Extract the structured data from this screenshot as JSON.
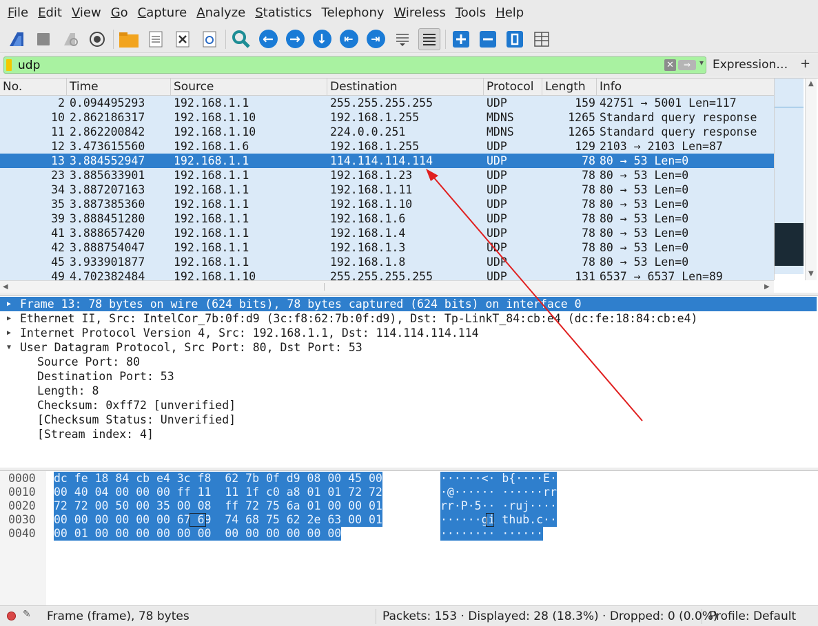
{
  "menu": [
    {
      "label": "File",
      "u": "F",
      "rest": "ile"
    },
    {
      "label": "Edit",
      "u": "E",
      "rest": "dit"
    },
    {
      "label": "View",
      "u": "V",
      "rest": "iew"
    },
    {
      "label": "Go",
      "u": "G",
      "rest": "o"
    },
    {
      "label": "Capture",
      "u": "C",
      "rest": "apture"
    },
    {
      "label": "Analyze",
      "u": "A",
      "rest": "nalyze"
    },
    {
      "label": "Statistics",
      "u": "S",
      "rest": "tatistics"
    },
    {
      "label": "Telephony",
      "u": "",
      "rest": "Telephony"
    },
    {
      "label": "Wireless",
      "u": "W",
      "rest": "ireless"
    },
    {
      "label": "Tools",
      "u": "T",
      "rest": "ools"
    },
    {
      "label": "Help",
      "u": "H",
      "rest": "elp"
    }
  ],
  "filter": {
    "value": "udp",
    "expression_label": "Expression…",
    "add_label": "+",
    "clear_label": "✕",
    "apply_label": "⇒",
    "dropdown_label": "▾"
  },
  "columns": {
    "no": "No.",
    "time": "Time",
    "source": "Source",
    "destination": "Destination",
    "protocol": "Protocol",
    "length": "Length",
    "info": "Info"
  },
  "packets": [
    {
      "no": "2",
      "time": "0.094495293",
      "source": "192.168.1.1",
      "destination": "255.255.255.255",
      "protocol": "UDP",
      "length": "159",
      "info": "42751 → 5001 Len=117"
    },
    {
      "no": "10",
      "time": "2.862186317",
      "source": "192.168.1.10",
      "destination": "192.168.1.255",
      "protocol": "MDNS",
      "length": "1265",
      "info": "Standard query response"
    },
    {
      "no": "11",
      "time": "2.862200842",
      "source": "192.168.1.10",
      "destination": "224.0.0.251",
      "protocol": "MDNS",
      "length": "1265",
      "info": "Standard query response"
    },
    {
      "no": "12",
      "time": "3.473615560",
      "source": "192.168.1.6",
      "destination": "192.168.1.255",
      "protocol": "UDP",
      "length": "129",
      "info": "2103 → 2103 Len=87"
    },
    {
      "no": "13",
      "time": "3.884552947",
      "source": "192.168.1.1",
      "destination": "114.114.114.114",
      "protocol": "UDP",
      "length": "78",
      "info": "80 → 53 Len=0",
      "selected": true
    },
    {
      "no": "23",
      "time": "3.885633901",
      "source": "192.168.1.1",
      "destination": "192.168.1.23",
      "protocol": "UDP",
      "length": "78",
      "info": "80 → 53 Len=0"
    },
    {
      "no": "34",
      "time": "3.887207163",
      "source": "192.168.1.1",
      "destination": "192.168.1.11",
      "protocol": "UDP",
      "length": "78",
      "info": "80 → 53 Len=0"
    },
    {
      "no": "35",
      "time": "3.887385360",
      "source": "192.168.1.1",
      "destination": "192.168.1.10",
      "protocol": "UDP",
      "length": "78",
      "info": "80 → 53 Len=0"
    },
    {
      "no": "39",
      "time": "3.888451280",
      "source": "192.168.1.1",
      "destination": "192.168.1.6",
      "protocol": "UDP",
      "length": "78",
      "info": "80 → 53 Len=0"
    },
    {
      "no": "41",
      "time": "3.888657420",
      "source": "192.168.1.1",
      "destination": "192.168.1.4",
      "protocol": "UDP",
      "length": "78",
      "info": "80 → 53 Len=0"
    },
    {
      "no": "42",
      "time": "3.888754047",
      "source": "192.168.1.1",
      "destination": "192.168.1.3",
      "protocol": "UDP",
      "length": "78",
      "info": "80 → 53 Len=0"
    },
    {
      "no": "45",
      "time": "3.933901877",
      "source": "192.168.1.1",
      "destination": "192.168.1.8",
      "protocol": "UDP",
      "length": "78",
      "info": "80 → 53 Len=0"
    },
    {
      "no": "49",
      "time": "4.702382484",
      "source": "192.168.1.10",
      "destination": "255.255.255.255",
      "protocol": "UDP",
      "length": "131",
      "info": "6537 → 6537 Len=89"
    }
  ],
  "details": {
    "frame": "Frame 13: 78 bytes on wire (624 bits), 78 bytes captured (624 bits) on interface 0",
    "ethernet": "Ethernet II, Src: IntelCor_7b:0f:d9 (3c:f8:62:7b:0f:d9), Dst: Tp-LinkT_84:cb:e4 (dc:fe:18:84:cb:e4)",
    "ip": "Internet Protocol Version 4, Src: 192.168.1.1, Dst: 114.114.114.114",
    "udp": "User Datagram Protocol, Src Port: 80, Dst Port: 53",
    "udp_fields": [
      "Source Port: 80",
      "Destination Port: 53",
      "Length: 8",
      "Checksum: 0xff72 [unverified]",
      "[Checksum Status: Unverified]",
      "[Stream index: 4]"
    ]
  },
  "bytes": [
    {
      "offset": "0000",
      "hex": "dc fe 18 84 cb e4 3c f8  62 7b 0f d9 08 00 45 00",
      "ascii": "······<· b{····E·"
    },
    {
      "offset": "0010",
      "hex": "00 40 04 00 00 00 ff 11  11 1f c0 a8 01 01 72 72",
      "ascii": "·@······ ······rr"
    },
    {
      "offset": "0020",
      "hex": "72 72 00 50 00 35 00 08  ff 72 75 6a 01 00 00 01",
      "ascii": "rr·P·5·· ·ruj····"
    },
    {
      "offset": "0030",
      "hex": "00 00 00 00 00 00 67 69  74 68 75 62 2e 63 00 01",
      "ascii": "······gi thub.c··"
    },
    {
      "offset": "0040",
      "hex": "00 01 00 00 00 00 00 00  00 00 00 00 00 00",
      "ascii": "········ ······"
    }
  ],
  "status": {
    "frame": "Frame (frame), 78 bytes",
    "packets": "Packets: 153 · Displayed: 28 (18.3%) · Dropped: 0 (0.0%)",
    "profile": "Profile: Default"
  },
  "colors": {
    "selected": "#2f7fcd",
    "row_udp": "#dbeaf8",
    "filter_ok": "#a9f2a1",
    "annotation": "#e02020"
  }
}
